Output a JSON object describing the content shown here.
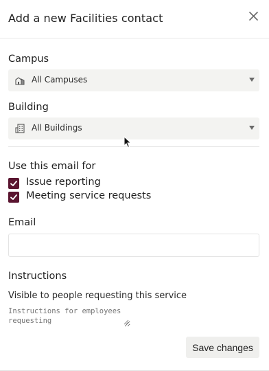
{
  "dialog": {
    "title": "Add a new Facilities contact",
    "close_icon": "close-icon"
  },
  "campus": {
    "label": "Campus",
    "selected": "All Campuses",
    "icon": "campus-building-icon"
  },
  "building": {
    "label": "Building",
    "selected": "All Buildings",
    "icon": "office-building-icon"
  },
  "usage": {
    "label": "Use this email for",
    "options": [
      {
        "label": "Issue reporting",
        "checked": true
      },
      {
        "label": "Meeting service requests",
        "checked": true
      }
    ]
  },
  "email": {
    "label": "Email",
    "value": ""
  },
  "instructions": {
    "label": "Instructions",
    "sublabel": "Visible to people requesting this service",
    "placeholder": "Instructions for employees requesting"
  },
  "actions": {
    "save_label": "Save changes"
  },
  "colors": {
    "checkbox": "#5a1530",
    "select_bg": "#f3f3f1",
    "button_bg": "#efefed"
  }
}
